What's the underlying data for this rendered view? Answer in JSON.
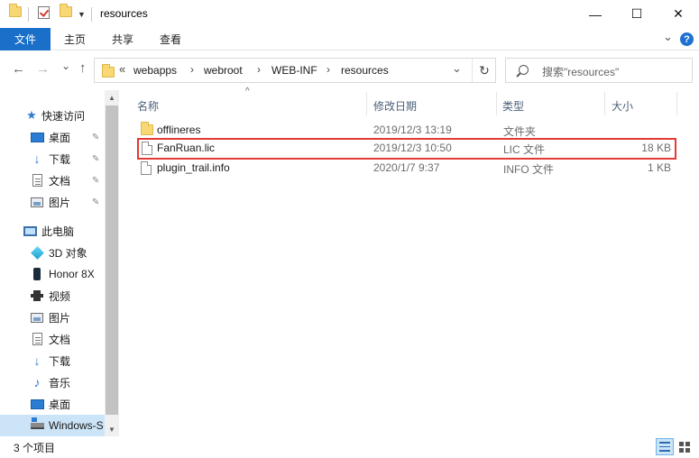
{
  "window": {
    "title": "resources",
    "minimize_glyph": "—",
    "maximize_glyph": "☐",
    "close_glyph": "✕",
    "quick_access_arrow": "▼"
  },
  "ribbon": {
    "tabs": [
      {
        "label": "文件",
        "active": true
      },
      {
        "label": "主页"
      },
      {
        "label": "共享"
      },
      {
        "label": "查看"
      }
    ],
    "expand_glyph": "⌄",
    "help_glyph": "?"
  },
  "navigation": {
    "back_glyph": "←",
    "forward_glyph": "→",
    "recent_glyph": "⌄",
    "up_glyph": "↑",
    "path_overflow": "«",
    "breadcrumbs": [
      "webapps",
      "webroot",
      "WEB-INF",
      "resources"
    ],
    "crumb_sep": "›",
    "dropdown_glyph": "⌄",
    "refresh_glyph": "↻",
    "search_placeholder": "搜索\"resources\""
  },
  "sidebar": {
    "items": [
      {
        "label": "快速访问",
        "icon": "star-icon",
        "pinned": false
      },
      {
        "label": "桌面",
        "icon": "desktop-icon",
        "pinned": true
      },
      {
        "label": "下载",
        "icon": "download-icon",
        "pinned": true
      },
      {
        "label": "文档",
        "icon": "document-icon",
        "pinned": true
      },
      {
        "label": "图片",
        "icon": "picture-icon",
        "pinned": true
      },
      {
        "label": "此电脑",
        "icon": "this-pc-icon",
        "pinned": false
      },
      {
        "label": "3D 对象",
        "icon": "3d-objects-icon",
        "pinned": false
      },
      {
        "label": "Honor 8X",
        "icon": "phone-icon",
        "pinned": false
      },
      {
        "label": "视频",
        "icon": "video-icon",
        "pinned": false
      },
      {
        "label": "图片",
        "icon": "picture-icon",
        "pinned": false
      },
      {
        "label": "文档",
        "icon": "document-icon",
        "pinned": false
      },
      {
        "label": "下载",
        "icon": "download-icon",
        "pinned": false
      },
      {
        "label": "音乐",
        "icon": "music-icon",
        "pinned": false
      },
      {
        "label": "桌面",
        "icon": "desktop-icon",
        "pinned": false
      },
      {
        "label": "Windows-S",
        "icon": "drive-icon",
        "pinned": false,
        "selected": true
      }
    ],
    "pin_glyph": "📌",
    "scroll_up_glyph": "▲",
    "scroll_down_glyph": "▼"
  },
  "file_list": {
    "sort_glyph": "^",
    "columns": [
      "名称",
      "修改日期",
      "类型",
      "大小"
    ],
    "rows": [
      {
        "name": "offlineres",
        "modified": "2019/12/3 13:19",
        "type": "文件夹",
        "size": "",
        "icon": "folder-icon"
      },
      {
        "name": "FanRuan.lic",
        "modified": "2019/12/3 10:50",
        "type": "LIC 文件",
        "size": "18 KB",
        "icon": "file-icon",
        "highlighted": true
      },
      {
        "name": "plugin_trail.info",
        "modified": "2020/1/7 9:37",
        "type": "INFO 文件",
        "size": "1 KB",
        "icon": "file-icon"
      }
    ]
  },
  "status": {
    "item_count": "3 个项目"
  },
  "colors": {
    "accent": "#1a6fc8",
    "selection": "#cce4f7",
    "highlight_border": "#e53935"
  }
}
